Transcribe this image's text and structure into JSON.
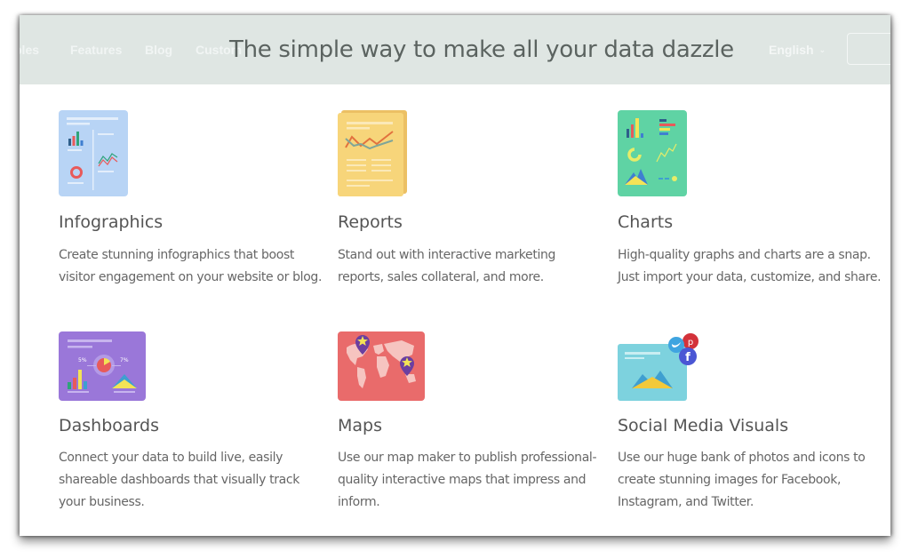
{
  "header": {
    "nav_items": [
      "ples",
      "Features",
      "Blog",
      "Custom"
    ],
    "headline": "The simple way to make all your data dazzle",
    "language": "English",
    "colors": {
      "bar_bg": "#dfe6e3",
      "headline": "#5b6360",
      "nav_text": "#f4f7f6"
    }
  },
  "features": [
    {
      "title": "Infographics",
      "description": "Create stunning infographics that boost visitor engagement on your website or blog.",
      "icon": "infographic-icon",
      "color": "#b8d4f5"
    },
    {
      "title": "Reports",
      "description": "Stand out with interactive marketing reports, sales collateral, and more.",
      "icon": "report-icon",
      "color": "#f7d57a"
    },
    {
      "title": "Charts",
      "description": "High-quality graphs and charts are a snap. Just import your data, customize, and share.",
      "icon": "charts-icon",
      "color": "#5fd3a4"
    },
    {
      "title": "Dashboards",
      "description": "Connect your data to build live, easily shareable dashboards that visually track your business.",
      "icon": "dashboard-icon",
      "color": "#9a77d9",
      "labels": [
        "5%",
        "7%"
      ]
    },
    {
      "title": "Maps",
      "description": "Use our map maker to publish professional-quality interactive maps that impress and inform.",
      "icon": "world-map-icon",
      "color": "#e96b6b"
    },
    {
      "title": "Social Media Visuals",
      "description": "Use our huge bank of photos and icons to create stunning images for Facebook, Instagram, and Twitter.",
      "icon": "social-media-icon",
      "color": "#7dd2de"
    }
  ]
}
